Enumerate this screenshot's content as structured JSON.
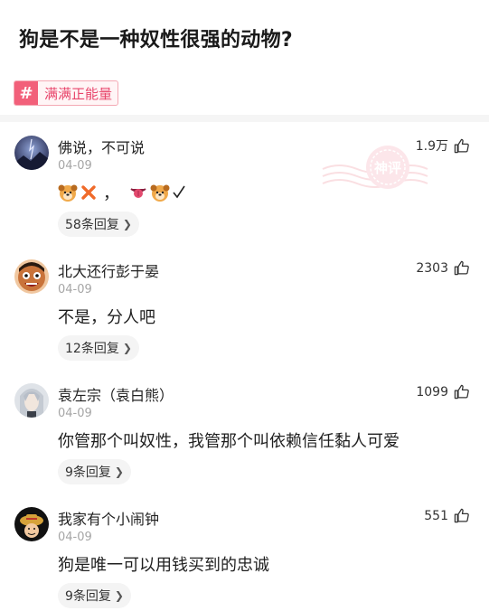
{
  "question": {
    "title": "狗是不是一种奴性很强的动物?"
  },
  "topic": {
    "hash": "#",
    "label": "满满正能量"
  },
  "stamp": {
    "text": "神评"
  },
  "comments": [
    {
      "username": "佛说，不可说",
      "date": "04-09",
      "likes": "1.9万",
      "body_text": "，",
      "replies": "58条回复"
    },
    {
      "username": "北大还行彭于晏",
      "date": "04-09",
      "likes": "2303",
      "body_text": "不是，分人吧",
      "replies": "12条回复"
    },
    {
      "username": "袁左宗（袁白熊）",
      "date": "04-09",
      "likes": "1099",
      "body_text": "你管那个叫奴性，我管那个叫依赖信任黏人可爱",
      "replies": "9条回复"
    },
    {
      "username": "我家有个小闹钟",
      "date": "04-09",
      "likes": "551",
      "body_text": "狗是唯一可以用钱买到的忠诚",
      "replies": "9条回复"
    }
  ],
  "colors": {
    "accent": "#f2607a",
    "tag_text": "#e8456b",
    "date": "#a6a6a6",
    "pill_bg": "#f4f4f4"
  },
  "icons": {
    "like": "thumbs-up-icon",
    "chevron": "chevron-right-icon",
    "dog": "dog-face-emoji",
    "cross": "cross-mark-emoji",
    "tongue": "tongue-emoji",
    "check": "check-mark"
  }
}
